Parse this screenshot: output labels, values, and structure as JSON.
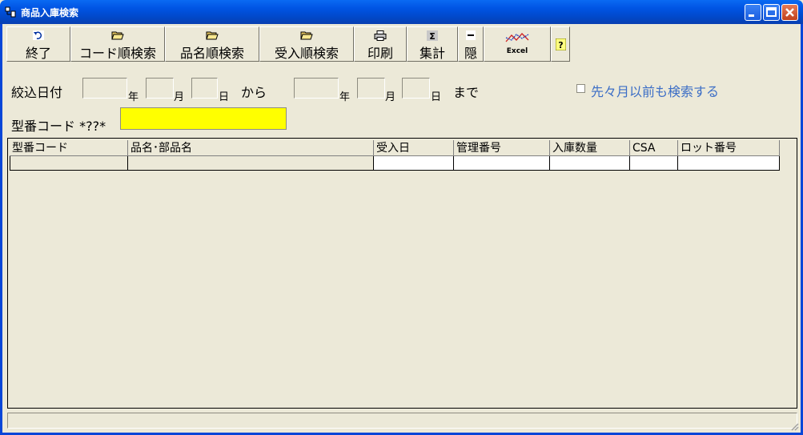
{
  "window": {
    "title": "商品入庫検索"
  },
  "toolbar": {
    "exit": "終了",
    "code_search": "コード順検索",
    "name_search": "品名順検索",
    "receive_search": "受入順検索",
    "print": "印刷",
    "total": "集計",
    "hide": "隠",
    "excel": "Excel",
    "help": "?"
  },
  "filter": {
    "date_label": "絞込日付",
    "year": "年",
    "month": "月",
    "day": "日",
    "from": "から",
    "to": "まで",
    "checkbox_label": "先々月以前も検索する",
    "code_label": "型番コード *??*",
    "code_value": ""
  },
  "table": {
    "columns": [
      "型番コード",
      "品名･部品名",
      "受入日",
      "管理番号",
      "入庫数量",
      "CSA",
      "ロット番号"
    ]
  },
  "colors": {
    "titlebar": "#0054e3",
    "highlight_input": "#ffff00",
    "checkbox_label": "#3c6ec6"
  }
}
